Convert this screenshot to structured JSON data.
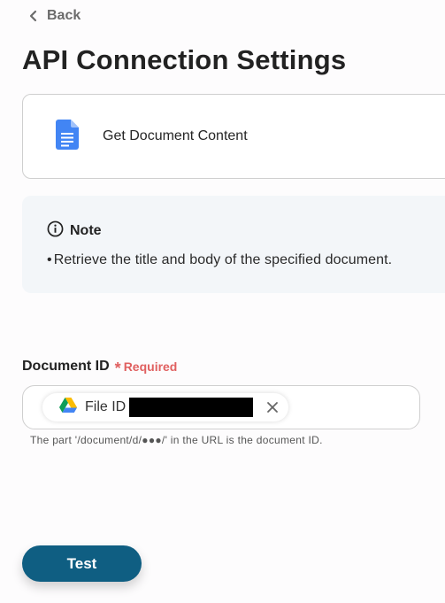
{
  "nav": {
    "back_label": "Back"
  },
  "page": {
    "title": "API Connection Settings"
  },
  "action": {
    "label": "Get Document Content",
    "icon": "google-docs-icon"
  },
  "note": {
    "heading": "Note",
    "bullet": "•",
    "text": "Retrieve the title and body of the specified document."
  },
  "field": {
    "label": "Document ID",
    "required_mark": "*",
    "required_text": "Required",
    "chip_label": "File ID",
    "chip_icon": "google-drive-icon",
    "hint": "The part '/document/d/●●●/' in the URL is the document ID."
  },
  "buttons": {
    "test_label": "Test"
  },
  "colors": {
    "accent": "#0f5e82",
    "required": "#e06060",
    "note_bg": "#f3f6f9",
    "docs_blue": "#4285f4"
  }
}
